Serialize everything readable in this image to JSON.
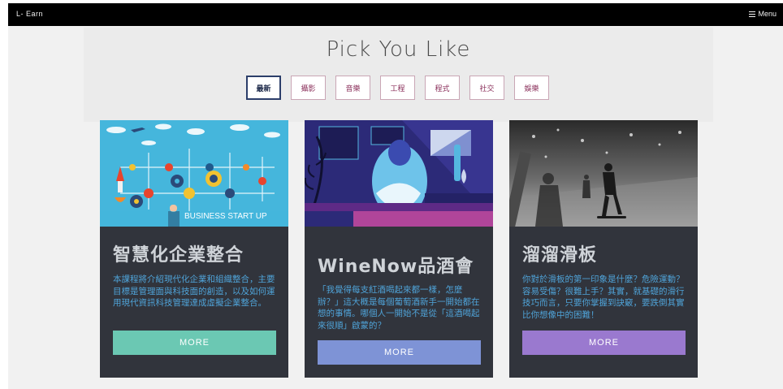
{
  "topbar": {
    "brand": "L- Earn",
    "menu_label": "Menu",
    "menu_icon": "hamburger-icon"
  },
  "hero": {
    "title": "Pick You Like",
    "tabs": [
      {
        "label": "最新",
        "active": true
      },
      {
        "label": "攝影",
        "active": false
      },
      {
        "label": "音樂",
        "active": false
      },
      {
        "label": "工程",
        "active": false
      },
      {
        "label": "程式",
        "active": false
      },
      {
        "label": "社交",
        "active": false
      },
      {
        "label": "娛樂",
        "active": false
      }
    ]
  },
  "cards": [
    {
      "image_caption": "BUSINESS START UP",
      "title": "智慧化企業整合",
      "description": "本課程將介紹現代化企業和組織整合，主要目標是管理面與科技面的創造，以及如何運用現代資訊科技管理達成虛擬企業整合。",
      "button_label": "MORE",
      "button_color": "#6bc8b3"
    },
    {
      "title": "WineNow品酒會",
      "description": "「我覺得每支紅酒喝起來都一樣，怎麼辦？」這大概是每個葡萄酒新手一開始都在想的事情。哪個人一開始不是從「這酒喝起來很順」啟蒙的？",
      "button_label": "MORE",
      "button_color": "#7e93d6"
    },
    {
      "title": "溜溜滑板",
      "description": "你對於滑板的第一印象是什麼？危險運動？容易受傷？很難上手？其實，就基礎的滑行技巧而言，只要你掌握到訣竅，要跌倒其實比你想像中的困難！",
      "button_label": "MORE",
      "button_color": "#9a79cf"
    }
  ],
  "colors": {
    "topbar_bg": "#000000",
    "card_bg": "#31343c",
    "desc_text": "#4fa3d8",
    "tab_text": "#8a2f5a"
  }
}
